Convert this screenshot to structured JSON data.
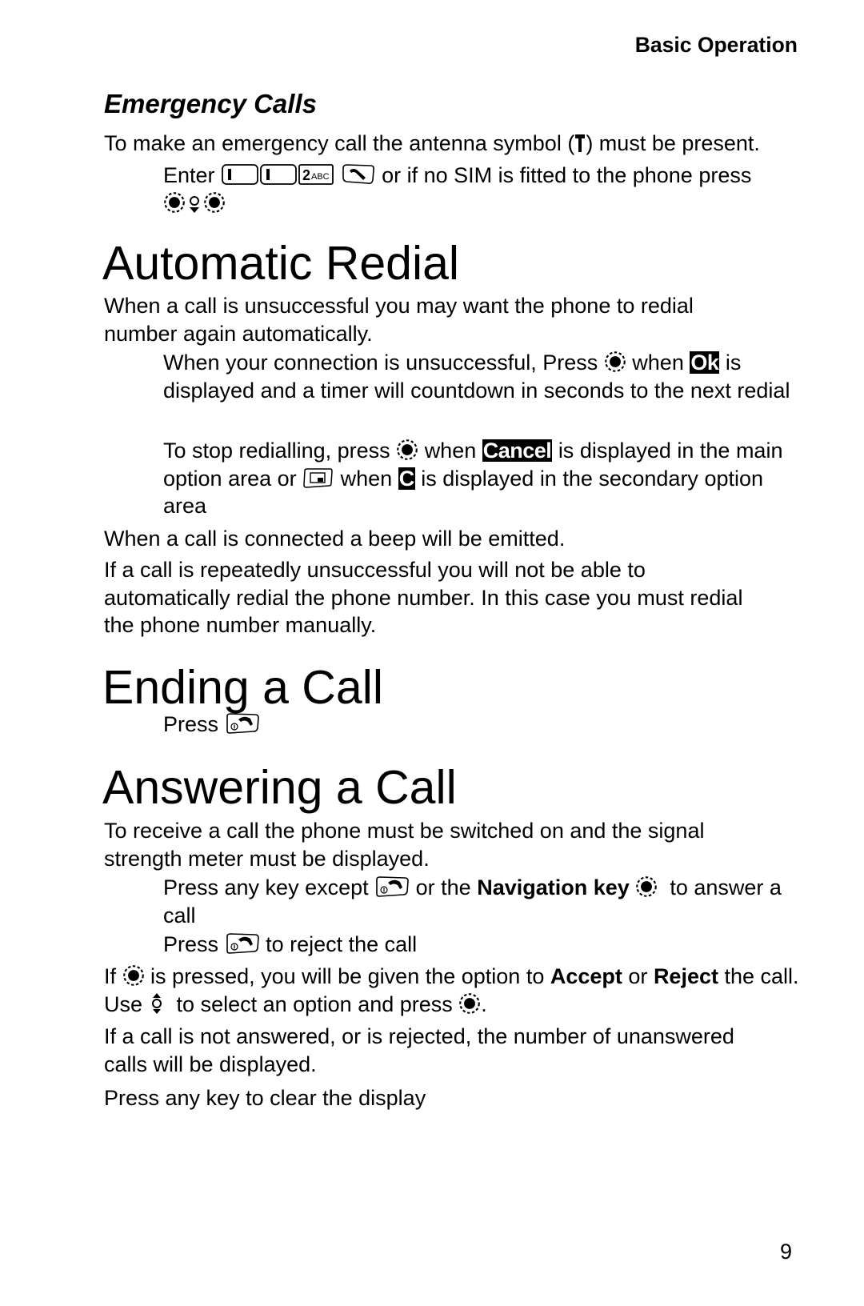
{
  "header": {
    "section": "Basic Operation"
  },
  "emergency": {
    "title": "Emergency Calls",
    "intro_before": "To make an emergency call the antenna symbol (",
    "intro_after": ") must be present.",
    "step_enter": "Enter",
    "step_middle": "or if no SIM is fitted to the phone press",
    "keys": [
      "1",
      "1",
      "2ABC"
    ],
    "icons": [
      "antenna-icon",
      "key-1-icon",
      "key-1-icon",
      "key-2abc-icon",
      "call-send-key-icon",
      "nav-select-icon",
      "nav-down-icon",
      "nav-select-icon"
    ]
  },
  "redial": {
    "title": "Automatic Redial",
    "intro": "When a call is unsuccessful you may want the phone to redial number again automatically.",
    "step1_a": "When your connection is unsuccessful, Press",
    "step1_b": "when",
    "step1_badge": "Ok",
    "step1_c": "is displayed and a timer will countdown in seconds to the next redial",
    "step2_a": "To stop redialling, press",
    "step2_b": "when",
    "step2_badge": "Cancel",
    "step2_c": "is displayed in the main option area or",
    "step2_d": "when",
    "step2_badge2": "C",
    "step2_e": "is displayed in the secondary option area",
    "note1": "When a call is connected a beep will be emitted.",
    "note2": "If a call is repeatedly unsuccessful you will not be able to automatically redial the phone number. In this case you must redial the phone number manually."
  },
  "ending": {
    "title": "Ending a Call",
    "step": "Press"
  },
  "answering": {
    "title": "Answering a Call",
    "intro": "To receive a call the phone must be switched on and the signal strength meter must be displayed.",
    "step1_a": "Press any key except",
    "step1_b": "or the",
    "step1_bold": "Navigation key",
    "step1_c": "to answer a call",
    "step2_a": "Press",
    "step2_b": "to reject the call",
    "para1_a": "If",
    "para1_b": "is pressed, you will be given the option to",
    "para1_accept": "Accept",
    "para1_or": "or",
    "para1_reject": "Reject",
    "para1_c": "the call. Use",
    "para1_d": "to select an option and press",
    "para1_e": ".",
    "para2": "If a call is not answered, or is rejected, the number of unanswered calls will be displayed.",
    "para3": "Press any key to clear the display"
  },
  "footer": {
    "page_number": "9"
  }
}
